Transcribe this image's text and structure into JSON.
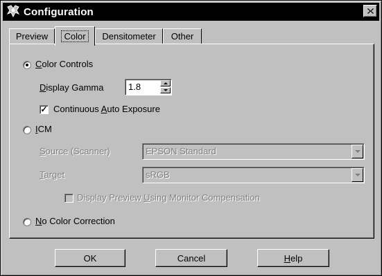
{
  "window": {
    "title": "Configuration",
    "close_label": "x"
  },
  "tabs": [
    {
      "label": "Preview",
      "active": false
    },
    {
      "label": "Color",
      "active": true
    },
    {
      "label": "Densitometer",
      "active": false
    },
    {
      "label": "Other",
      "active": false
    }
  ],
  "color_controls": {
    "label": "Color Controls",
    "selected": true,
    "display_gamma_label": "Display Gamma",
    "display_gamma_value": "1.8",
    "continuous_auto_exposure_label": "Continuous Auto Exposure",
    "continuous_auto_exposure_checked": true
  },
  "icm": {
    "label": "ICM",
    "selected": false,
    "source_label": "Source (Scanner)",
    "source_value": "EPSON Standard",
    "target_label": "Target",
    "target_value": "sRGB",
    "monitor_compensation_label": "Display Preview Using Monitor Compensation",
    "monitor_compensation_checked": false
  },
  "no_color_correction": {
    "label": "No Color Correction",
    "selected": false
  },
  "buttons": {
    "ok": "OK",
    "cancel": "Cancel",
    "help": "Help"
  }
}
